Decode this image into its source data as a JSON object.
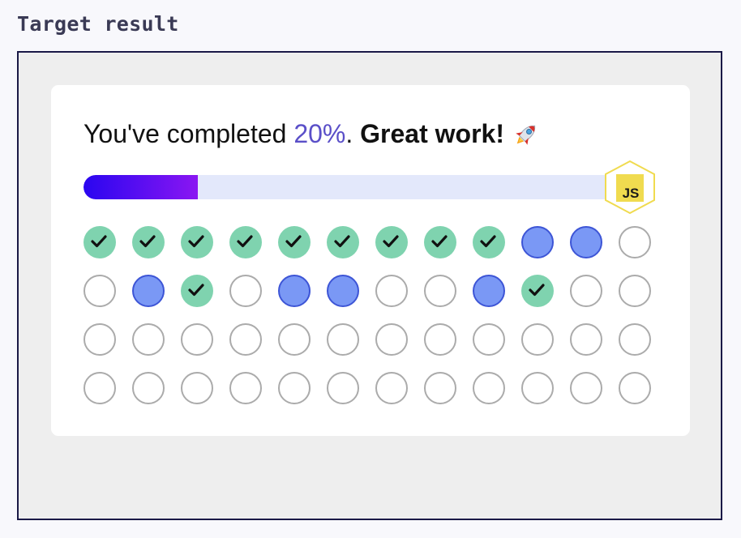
{
  "heading": "Target result",
  "message": {
    "prefix": "You've completed ",
    "percent": "20%",
    "separator": ". ",
    "praise": "Great work!",
    "emoji_icon": "rocket-icon"
  },
  "progress": {
    "value": 0.2,
    "gradient_start": "#2a06f0",
    "gradient_end": "#8a16f2",
    "track_color": "#e3e8fb"
  },
  "badge": {
    "label": "JS",
    "icon": "javascript-hexagon-icon",
    "color": "#f0db4f"
  },
  "grid": {
    "columns": 12,
    "legend_colors": {
      "done": "#7fd3af",
      "partial": "#7a98f5",
      "empty": "#ffffff"
    },
    "cells": [
      "done",
      "done",
      "done",
      "done",
      "done",
      "done",
      "done",
      "done",
      "done",
      "partial",
      "partial",
      "empty",
      "empty",
      "partial",
      "done",
      "empty",
      "partial",
      "partial",
      "empty",
      "empty",
      "partial",
      "done",
      "empty",
      "empty",
      "empty",
      "empty",
      "empty",
      "empty",
      "empty",
      "empty",
      "empty",
      "empty",
      "empty",
      "empty",
      "empty",
      "empty",
      "empty",
      "empty",
      "empty",
      "empty",
      "empty",
      "empty",
      "empty",
      "empty",
      "empty",
      "empty",
      "empty",
      "empty"
    ]
  }
}
